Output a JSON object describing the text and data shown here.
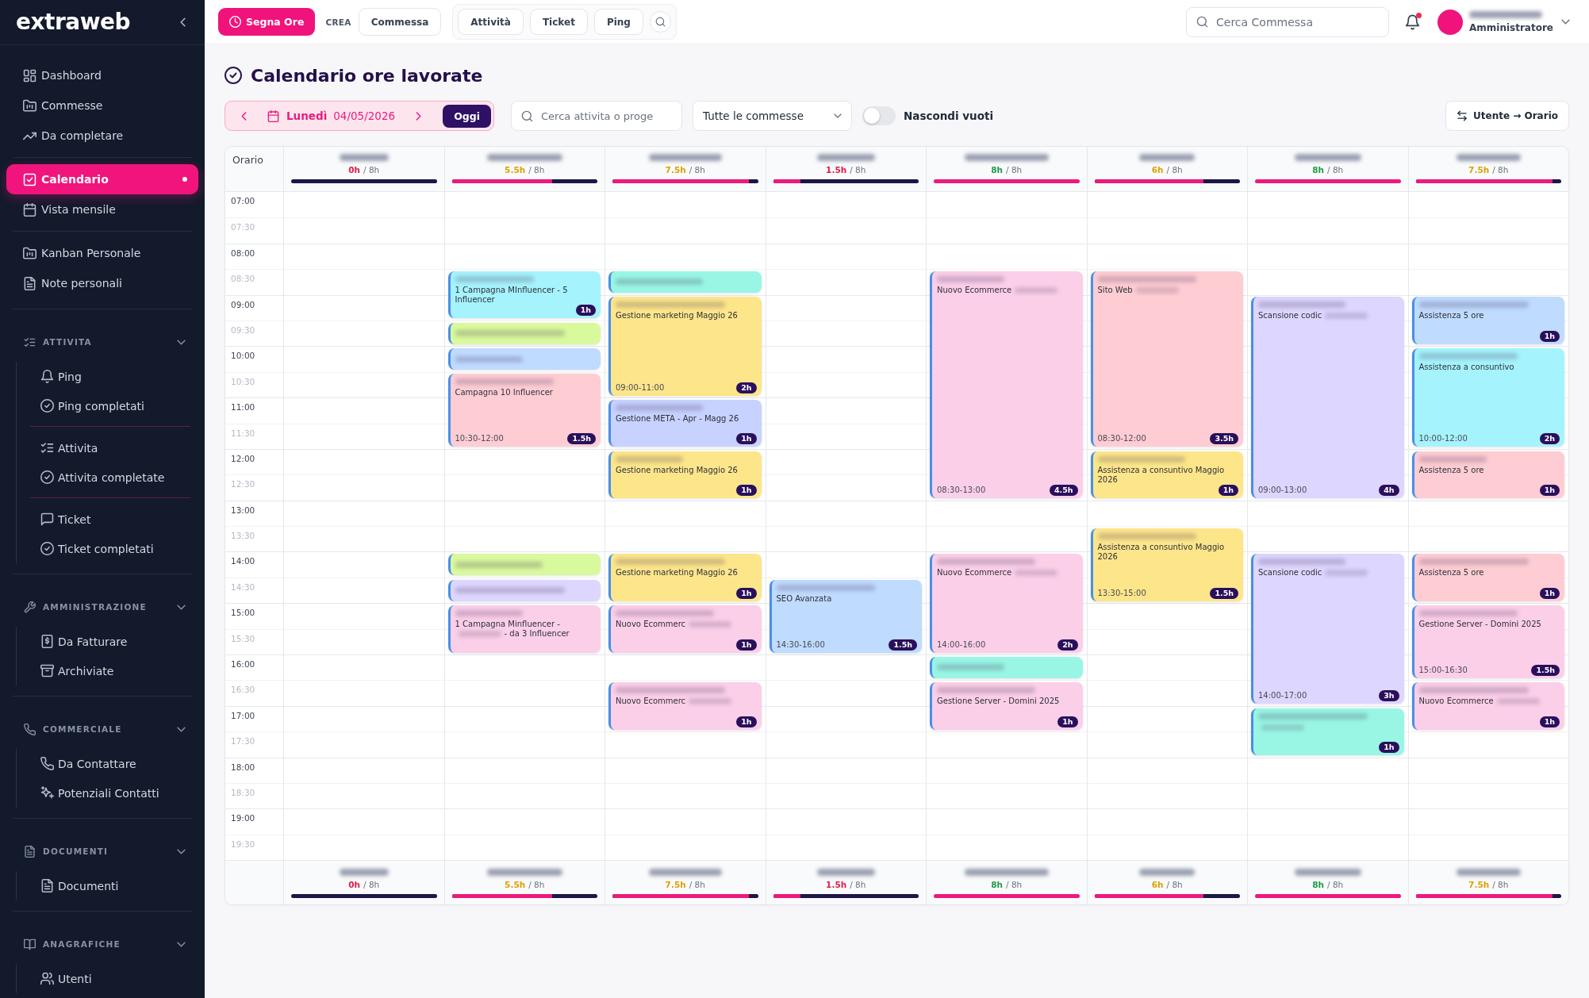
{
  "sidebar": {
    "logo": "extraweb",
    "nav_groups": [
      {
        "items": [
          {
            "label": "Dashboard",
            "selected": false
          },
          {
            "label": "Commesse",
            "selected": false
          },
          {
            "label": "Da completare",
            "selected": false
          }
        ]
      },
      {
        "items": [
          {
            "label": "Calendario",
            "selected": true
          },
          {
            "label": "Vista mensile",
            "selected": false
          }
        ]
      },
      {
        "items": [
          {
            "label": "Kanban Personale",
            "selected": false
          },
          {
            "label": "Note personali",
            "selected": false
          }
        ]
      }
    ],
    "sections": [
      {
        "title": "ATTIVITA",
        "expanded": true,
        "groups": [
          {
            "items": [
              {
                "label": "Ping",
                "selected": false
              },
              {
                "label": "Ping completati",
                "selected": false
              }
            ]
          },
          {
            "items": [
              {
                "label": "Attivita",
                "selected": false
              },
              {
                "label": "Attivita completate",
                "selected": false
              }
            ]
          },
          {
            "items": [
              {
                "label": "Ticket",
                "selected": false
              },
              {
                "label": "Ticket completati",
                "selected": false
              }
            ]
          }
        ]
      },
      {
        "title": "AMMINISTRAZIONE",
        "expanded": true,
        "groups": [
          {
            "items": [
              {
                "label": "Da Fatturare",
                "selected": false
              },
              {
                "label": "Archiviate",
                "selected": false
              }
            ]
          }
        ]
      },
      {
        "title": "COMMERCIALE",
        "expanded": true,
        "groups": [
          {
            "items": [
              {
                "label": "Da Contattare",
                "selected": false
              },
              {
                "label": "Potenziali Contatti",
                "selected": false
              }
            ]
          }
        ]
      },
      {
        "title": "DOCUMENTI",
        "expanded": true,
        "groups": [
          {
            "items": [
              {
                "label": "Documenti",
                "selected": false
              }
            ]
          }
        ]
      },
      {
        "title": "ANAGRAFICHE",
        "expanded": true,
        "groups": [
          {
            "items": [
              {
                "label": "Utenti",
                "selected": false
              }
            ]
          }
        ]
      }
    ]
  },
  "topbar": {
    "primary_button": "Segna Ore",
    "create_label": "CREA",
    "create_buttons": [
      "Commessa"
    ],
    "quick_buttons": [
      "Attività",
      "Ticket",
      "Ping"
    ],
    "search": {
      "placeholder": "Cerca Commessa"
    },
    "notifications": {
      "unread": true
    },
    "user": {
      "name_redacted": true,
      "role": "Amministratore"
    }
  },
  "page": {
    "title": "Calendario ore lavorate",
    "date_nav": {
      "day": "Lunedì",
      "date": "04/05/2026",
      "today_button": "Oggi"
    },
    "search": {
      "placeholder": "Cerca attivita o proge"
    },
    "filter": {
      "value": "Tutte le commesse"
    },
    "hide_empty": {
      "label": "Nascondi vuoti",
      "on": false
    },
    "view_toggle": "Utente → Orario"
  },
  "calendar": {
    "corner_label": "Orario",
    "time_slots": [
      {
        "label": "07:00",
        "kind": "hour"
      },
      {
        "label": "07:30",
        "kind": "half"
      },
      {
        "label": "08:00",
        "kind": "hour"
      },
      {
        "label": "08:30",
        "kind": "half"
      },
      {
        "label": "09:00",
        "kind": "hour"
      },
      {
        "label": "09:30",
        "kind": "half"
      },
      {
        "label": "10:00",
        "kind": "hour"
      },
      {
        "label": "10:30",
        "kind": "half"
      },
      {
        "label": "11:00",
        "kind": "hour"
      },
      {
        "label": "11:30",
        "kind": "half"
      },
      {
        "label": "12:00",
        "kind": "hour"
      },
      {
        "label": "12:30",
        "kind": "half"
      },
      {
        "label": "13:00",
        "kind": "hour"
      },
      {
        "label": "13:30",
        "kind": "half"
      },
      {
        "label": "14:00",
        "kind": "hour"
      },
      {
        "label": "14:30",
        "kind": "half"
      },
      {
        "label": "15:00",
        "kind": "hour"
      },
      {
        "label": "15:30",
        "kind": "half"
      },
      {
        "label": "16:00",
        "kind": "hour"
      },
      {
        "label": "16:30",
        "kind": "half"
      },
      {
        "label": "17:00",
        "kind": "hour"
      },
      {
        "label": "17:30",
        "kind": "half"
      },
      {
        "label": "18:00",
        "kind": "hour"
      },
      {
        "label": "18:30",
        "kind": "half"
      },
      {
        "label": "19:00",
        "kind": "hour"
      },
      {
        "label": "19:30",
        "kind": "half"
      }
    ],
    "columns": [
      {
        "name_redacted": true,
        "hours": "0h",
        "target": "/ 8h",
        "color": "#e11d48",
        "level": 0
      },
      {
        "name_redacted": true,
        "hours": "5.5h",
        "target": "/ 8h",
        "color": "#dfa100",
        "level": 0.6875,
        "slots": [
          {
            "kind": "free"
          },
          {
            "kind": "free"
          },
          {
            "kind": "free"
          },
          {
            "kind": "event",
            "color": "#a5f3fc",
            "title_redacted": true,
            "subtitle": "1 Campagna MInfluencer - 5 Influencer",
            "duration": "1h"
          },
          {
            "kind": "cont"
          },
          {
            "kind": "event",
            "color": "#d9f99d",
            "title_redacted": true
          },
          {
            "kind": "event",
            "color": "#bfdbfe",
            "title_redacted": true
          },
          {
            "kind": "event",
            "color": "#fecdd3",
            "title_redacted": true,
            "subtitle": "Campagna 10 Influencer",
            "time": "10:30-12:00",
            "duration": "1.5h"
          },
          {
            "kind": "cont"
          },
          {
            "kind": "cont"
          },
          {
            "kind": "free"
          },
          {
            "kind": "free"
          },
          {
            "kind": "free"
          },
          {
            "kind": "free"
          },
          {
            "kind": "event",
            "color": "#d9f99d",
            "title_redacted": true
          },
          {
            "kind": "event",
            "color": "#ddd6fe",
            "title_redacted": true
          },
          {
            "kind": "event",
            "color": "#fbcfe8",
            "title_redacted": true,
            "subtitle": "1 Campagna Minfluencer -",
            "subtitle_redacted_tail": true,
            "subtitle_after": "- da 3 Influencer"
          },
          {
            "kind": "cont"
          }
        ]
      },
      {
        "name_redacted": true,
        "hours": "7.5h",
        "target": "/ 8h",
        "color": "#dfa100",
        "level": 0.9375,
        "slots": [
          {
            "kind": "free"
          },
          {
            "kind": "free"
          },
          {
            "kind": "free"
          },
          {
            "kind": "event",
            "color": "#99f6e4",
            "title_redacted": true
          },
          {
            "kind": "event",
            "color": "#fde68a",
            "title_redacted": true,
            "subtitle": "Gestione marketing Maggio 26",
            "time": "09:00-11:00",
            "duration": "2h"
          },
          {
            "kind": "cont"
          },
          {
            "kind": "cont"
          },
          {
            "kind": "cont"
          },
          {
            "kind": "event",
            "color": "#c7d2fe",
            "title_redacted": true,
            "subtitle": "Gestione META - Apr - Magg 26",
            "duration": "1h"
          },
          {
            "kind": "cont"
          },
          {
            "kind": "event",
            "color": "#fde68a",
            "title_redacted": true,
            "subtitle": "Gestione marketing Maggio 26",
            "duration": "1h"
          },
          {
            "kind": "cont"
          },
          {
            "kind": "free"
          },
          {
            "kind": "free"
          },
          {
            "kind": "event",
            "color": "#fde68a",
            "title_redacted": true,
            "subtitle": "Gestione marketing Maggio 26",
            "duration": "1h"
          },
          {
            "kind": "cont"
          },
          {
            "kind": "event",
            "color": "#fbcfe8",
            "title_redacted": true,
            "subtitle": "Nuovo Ecommerc",
            "subtitle_redacted_tail": true,
            "duration": "1h"
          },
          {
            "kind": "cont"
          },
          {
            "kind": "free"
          },
          {
            "kind": "event",
            "color": "#fbcfe8",
            "title_redacted": true,
            "subtitle": "Nuovo Ecommerc",
            "subtitle_redacted_tail": true,
            "duration": "1h"
          },
          {
            "kind": "cont"
          }
        ]
      },
      {
        "name_redacted": true,
        "hours": "1.5h",
        "target": "/ 8h",
        "color": "#e11d48",
        "level": 0.1875,
        "slots": [
          {
            "kind": "free"
          },
          {
            "kind": "free"
          },
          {
            "kind": "free"
          },
          {
            "kind": "free"
          },
          {
            "kind": "free"
          },
          {
            "kind": "free"
          },
          {
            "kind": "free"
          },
          {
            "kind": "free"
          },
          {
            "kind": "free"
          },
          {
            "kind": "free"
          },
          {
            "kind": "free"
          },
          {
            "kind": "free"
          },
          {
            "kind": "free"
          },
          {
            "kind": "free"
          },
          {
            "kind": "free"
          },
          {
            "kind": "event",
            "color": "#bfdbfe",
            "title_redacted": true,
            "subtitle": "SEO Avanzata",
            "time": "14:30-16:00",
            "duration": "1.5h"
          },
          {
            "kind": "cont"
          },
          {
            "kind": "cont"
          }
        ]
      },
      {
        "name_redacted": true,
        "hours": "8h",
        "target": "/ 8h",
        "color": "#1f9d45",
        "level": 1,
        "slots": [
          {
            "kind": "free"
          },
          {
            "kind": "free"
          },
          {
            "kind": "free"
          },
          {
            "kind": "event",
            "color": "#fbcfe8",
            "title_redacted": true,
            "subtitle": "Nuovo Ecommerce",
            "subtitle_redacted_tail": true,
            "time": "08:30-13:00",
            "duration": "4.5h"
          },
          {
            "kind": "cont"
          },
          {
            "kind": "cont"
          },
          {
            "kind": "cont"
          },
          {
            "kind": "cont"
          },
          {
            "kind": "cont"
          },
          {
            "kind": "cont"
          },
          {
            "kind": "cont"
          },
          {
            "kind": "cont"
          },
          {
            "kind": "free"
          },
          {
            "kind": "free"
          },
          {
            "kind": "event",
            "color": "#fbcfe8",
            "title_redacted": true,
            "subtitle": "Nuovo Ecommerce",
            "subtitle_redacted_tail": true,
            "time": "14:00-16:00",
            "duration": "2h"
          },
          {
            "kind": "cont"
          },
          {
            "kind": "cont"
          },
          {
            "kind": "cont"
          },
          {
            "kind": "event",
            "color": "#99f6e4",
            "title_redacted": true
          },
          {
            "kind": "event",
            "color": "#fbcfe8",
            "title_redacted": true,
            "subtitle": "Gestione Server - Domini 2025",
            "duration": "1h"
          },
          {
            "kind": "cont"
          }
        ]
      },
      {
        "name_redacted": true,
        "hours": "6h",
        "target": "/ 8h",
        "color": "#dfa100",
        "level": 0.75,
        "slots": [
          {
            "kind": "free"
          },
          {
            "kind": "free"
          },
          {
            "kind": "free"
          },
          {
            "kind": "event",
            "color": "#fecdd3",
            "title_redacted": true,
            "subtitle": "Sito Web",
            "subtitle_redacted_tail": true,
            "time": "08:30-12:00",
            "duration": "3.5h"
          },
          {
            "kind": "cont"
          },
          {
            "kind": "cont"
          },
          {
            "kind": "cont"
          },
          {
            "kind": "cont"
          },
          {
            "kind": "cont"
          },
          {
            "kind": "cont"
          },
          {
            "kind": "event",
            "color": "#fde68a",
            "title_redacted": true,
            "subtitle": "Assistenza a consuntivo Maggio 2026",
            "duration": "1h"
          },
          {
            "kind": "cont"
          },
          {
            "kind": "free"
          },
          {
            "kind": "event",
            "color": "#fde68a",
            "title_redacted": true,
            "subtitle": "Assistenza a consuntivo Maggio 2026",
            "time": "13:30-15:00",
            "duration": "1.5h"
          },
          {
            "kind": "cont"
          },
          {
            "kind": "cont"
          }
        ]
      },
      {
        "name_redacted": true,
        "hours": "8h",
        "target": "/ 8h",
        "color": "#1f9d45",
        "level": 1,
        "slots": [
          {
            "kind": "free"
          },
          {
            "kind": "free"
          },
          {
            "kind": "free"
          },
          {
            "kind": "free"
          },
          {
            "kind": "event",
            "color": "#ddd6fe",
            "title_redacted": true,
            "subtitle": "Scansione codic",
            "subtitle_redacted_tail": true,
            "time": "09:00-13:00",
            "duration": "4h"
          },
          {
            "kind": "cont"
          },
          {
            "kind": "cont"
          },
          {
            "kind": "cont"
          },
          {
            "kind": "cont"
          },
          {
            "kind": "cont"
          },
          {
            "kind": "cont"
          },
          {
            "kind": "cont"
          },
          {
            "kind": "free"
          },
          {
            "kind": "free"
          },
          {
            "kind": "event",
            "color": "#ddd6fe",
            "title_redacted": true,
            "subtitle": "Scansione codic",
            "subtitle_redacted_tail": true,
            "time": "14:00-17:00",
            "duration": "3h"
          },
          {
            "kind": "cont"
          },
          {
            "kind": "cont"
          },
          {
            "kind": "cont"
          },
          {
            "kind": "cont"
          },
          {
            "kind": "cont"
          },
          {
            "kind": "event",
            "color": "#99f6e4",
            "title_redacted": true,
            "subtitle_redacted_tail": true,
            "duration": "1h"
          },
          {
            "kind": "cont"
          }
        ]
      },
      {
        "name_redacted": true,
        "hours": "7.5h",
        "target": "/ 8h",
        "color": "#dfa100",
        "level": 0.9375,
        "slots": [
          {
            "kind": "free"
          },
          {
            "kind": "free"
          },
          {
            "kind": "free"
          },
          {
            "kind": "free"
          },
          {
            "kind": "event",
            "color": "#bfdbfe",
            "title_redacted": true,
            "subtitle": "Assistenza 5 ore",
            "duration": "1h"
          },
          {
            "kind": "cont"
          },
          {
            "kind": "event",
            "color": "#a5f3fc",
            "title_redacted": true,
            "subtitle": "Assistenza a consuntivo",
            "time": "10:00-12:00",
            "duration": "2h"
          },
          {
            "kind": "cont"
          },
          {
            "kind": "cont"
          },
          {
            "kind": "cont"
          },
          {
            "kind": "event",
            "color": "#fecdd3",
            "title_redacted": true,
            "subtitle": "Assistenza 5 ore",
            "duration": "1h"
          },
          {
            "kind": "cont"
          },
          {
            "kind": "free"
          },
          {
            "kind": "free"
          },
          {
            "kind": "event",
            "color": "#fecdd3",
            "title_redacted": true,
            "subtitle": "Assistenza 5 ore",
            "duration": "1h"
          },
          {
            "kind": "cont"
          },
          {
            "kind": "event",
            "color": "#fbcfe8",
            "title_redacted": true,
            "subtitle": "Gestione Server - Domini 2025",
            "time": "15:00-16:30",
            "duration": "1.5h"
          },
          {
            "kind": "cont"
          },
          {
            "kind": "cont"
          },
          {
            "kind": "event",
            "color": "#fbcfe8",
            "title_redacted": true,
            "subtitle": "Nuovo Ecommerce",
            "subtitle_redacted_tail": true,
            "duration": "1h"
          },
          {
            "kind": "cont"
          }
        ]
      }
    ],
    "footer": [
      {
        "name_redacted": true,
        "hours": "0h",
        "target": "/ 8h",
        "color": "#e11d48",
        "level": 0
      },
      {
        "name_redacted": true,
        "hours": "5.5h",
        "target": "/ 8h",
        "color": "#dfa100",
        "level": 0.6875
      },
      {
        "name_redacted": true,
        "hours": "7.5h",
        "target": "/ 8h",
        "color": "#dfa100",
        "level": 0.9375
      },
      {
        "name_redacted": true,
        "hours": "1.5h",
        "target": "/ 8h",
        "color": "#e11d48",
        "level": 0.1875
      },
      {
        "name_redacted": true,
        "hours": "8h",
        "target": "/ 8h",
        "color": "#1f9d45",
        "level": 1
      },
      {
        "name_redacted": true,
        "hours": "6h",
        "target": "/ 8h",
        "color": "#dfa100",
        "level": 0.75
      },
      {
        "name_redacted": true,
        "hours": "8h",
        "target": "/ 8h",
        "color": "#1f9d45",
        "level": 1
      },
      {
        "name_redacted": true,
        "hours": "7.5h",
        "target": "/ 8h",
        "color": "#dfa100",
        "level": 0.9375
      }
    ]
  }
}
